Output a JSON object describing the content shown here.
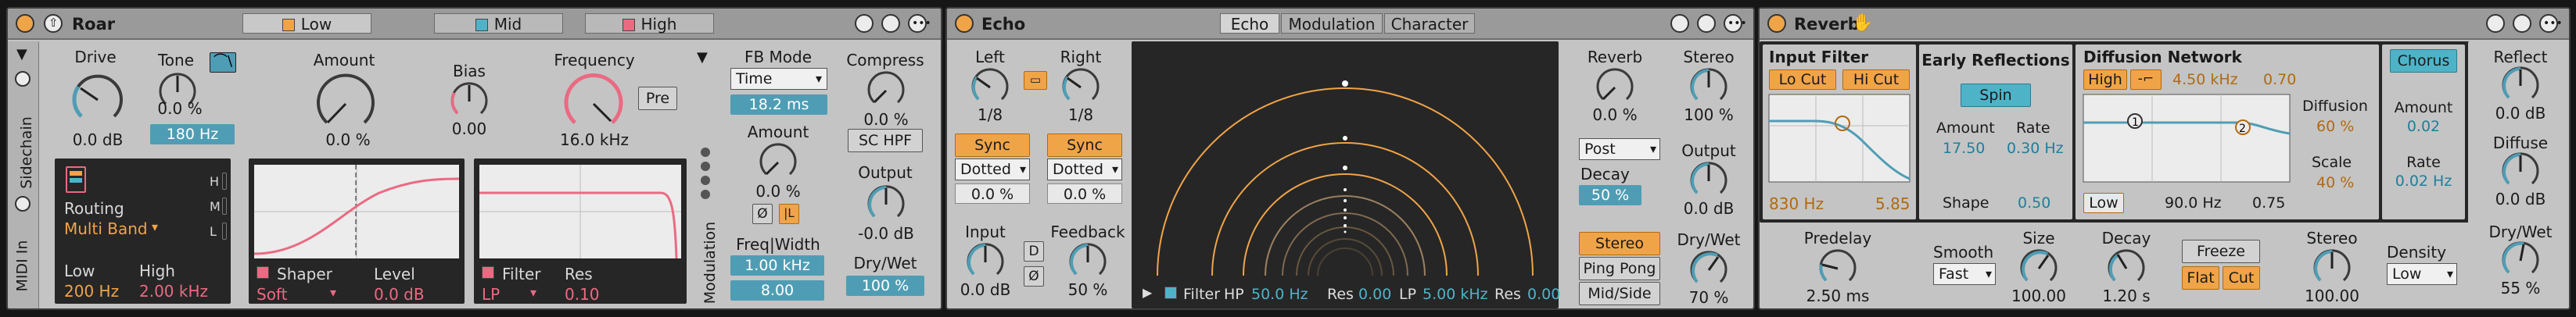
{
  "roar": {
    "title": "Roar",
    "tabs": [
      {
        "label": "Low",
        "color": "#f0a448"
      },
      {
        "label": "Mid",
        "color": "#4fb3c8"
      },
      {
        "label": "High",
        "color": "#ea6a82"
      }
    ],
    "side_labels": [
      "Sidechain",
      "MIDI In"
    ],
    "drive": {
      "label": "Drive",
      "value": "0.0 dB"
    },
    "tone": {
      "label": "Tone",
      "value": "0.0 %",
      "freq": "180 Hz"
    },
    "amount": {
      "label": "Amount",
      "value": "0.0 %"
    },
    "bias": {
      "label": "Bias",
      "value": "0.00"
    },
    "frequency": {
      "label": "Frequency",
      "value": "16.0 kHz"
    },
    "pre_label": "Pre",
    "routing": {
      "label": "Routing",
      "value": "Multi Band"
    },
    "hml": [
      "H",
      "M",
      "L"
    ],
    "low": {
      "label": "Low",
      "value": "200 Hz"
    },
    "high": {
      "label": "High",
      "value": "2.00 kHz"
    },
    "shaper": {
      "label": "Shaper",
      "value": "Soft"
    },
    "level": {
      "label": "Level",
      "value": "0.0 dB"
    },
    "filter": {
      "label": "Filter",
      "value": "LP"
    },
    "res": {
      "label": "Res",
      "value": "0.10"
    },
    "fb_mode": {
      "label": "FB Mode",
      "value": "Time",
      "amount": "18.2 ms"
    },
    "fb_amount": {
      "label": "Amount",
      "value": "0.0 %"
    },
    "freq_width": {
      "label": "Freq|Width",
      "freq": "1.00 kHz",
      "width": "8.00"
    },
    "modulation_label": "Modulation",
    "compress": {
      "label": "Compress",
      "value": "0.0 %"
    },
    "sc_hpf": "SC HPF",
    "output": {
      "label": "Output",
      "value": "-0.0 dB"
    },
    "drywet": {
      "label": "Dry/Wet",
      "value": "100 %"
    }
  },
  "echo": {
    "title": "Echo",
    "tabs": [
      "Echo",
      "Modulation",
      "Character"
    ],
    "left": {
      "label": "Left",
      "value": "1/8"
    },
    "right": {
      "label": "Right",
      "value": "1/8"
    },
    "sync": "Sync",
    "dotted": "Dotted",
    "offset": "0.0 %",
    "input": {
      "label": "Input",
      "value": "0.0 dB"
    },
    "feedback": {
      "label": "Feedback",
      "value": "50 %"
    },
    "d_label": "D",
    "filter": {
      "label": "Filter",
      "hp_label": "HP",
      "hp": "50.0 Hz",
      "res_label": "Res",
      "hp_res": "0.00",
      "lp_label": "LP",
      "lp": "5.00 kHz",
      "lp_res": "0.00"
    },
    "reverb": {
      "label": "Reverb",
      "value": "0.0 %"
    },
    "stereo": {
      "label": "Stereo",
      "value": "100 %"
    },
    "reverb_pos": "Post",
    "decay": {
      "label": "Decay",
      "value": "50 %"
    },
    "output": {
      "label": "Output",
      "value": "0.0 dB"
    },
    "stereo_btn": "Stereo",
    "pingpong": "Ping Pong",
    "midside": "Mid/Side",
    "drywet": {
      "label": "Dry/Wet",
      "value": "70 %"
    }
  },
  "reverb": {
    "title": "Reverb",
    "input_filter": {
      "label": "Input Filter",
      "lo_cut": "Lo Cut",
      "hi_cut": "Hi Cut",
      "freq": "830 Hz",
      "q": "5.85"
    },
    "early": {
      "label": "Early Reflections",
      "spin": "Spin",
      "amount_label": "Amount",
      "amount": "17.50",
      "rate_label": "Rate",
      "rate": "0.30 Hz",
      "shape_label": "Shape",
      "shape": "0.50"
    },
    "diffusion": {
      "label": "Diffusion Network",
      "high": "High",
      "freq": "4.50 kHz",
      "val": "0.70",
      "low": "Low",
      "low_freq": "90.0 Hz",
      "low_val": "0.75",
      "diff_label": "Diffusion",
      "diff": "60 %",
      "scale_label": "Scale",
      "scale": "40 %"
    },
    "chorus": {
      "label": "Chorus",
      "amount_label": "Amount",
      "amount": "0.02",
      "rate_label": "Rate",
      "rate": "0.02 Hz"
    },
    "reflect": {
      "label": "Reflect",
      "value": "0.0 dB"
    },
    "diffuse": {
      "label": "Diffuse",
      "value": "0.0 dB"
    },
    "drywet": {
      "label": "Dry/Wet",
      "value": "55 %"
    },
    "predelay": {
      "label": "Predelay",
      "value": "2.50 ms"
    },
    "smooth": {
      "label": "Smooth",
      "value": "Fast"
    },
    "size": {
      "label": "Size",
      "value": "100.00"
    },
    "decay": {
      "label": "Decay",
      "value": "1.20 s"
    },
    "freeze": "Freeze",
    "flat": "Flat",
    "cut": "Cut",
    "stereo": {
      "label": "Stereo",
      "value": "100.00"
    },
    "density": {
      "label": "Density",
      "value": "Low"
    }
  },
  "colors": {
    "orange": "#f0a448",
    "blue": "#4f9db4",
    "pink": "#ea6a82",
    "panel": "#c4c4c4",
    "dark": "#262626"
  }
}
